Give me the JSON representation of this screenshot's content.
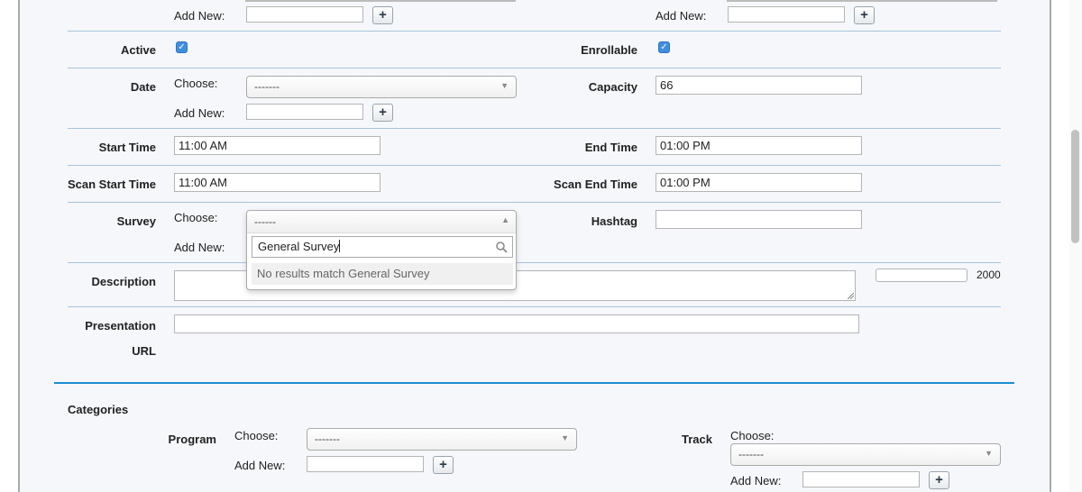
{
  "top_row": {
    "add_new_left": "Add New:",
    "add_new_right": "Add New:"
  },
  "active": {
    "label": "Active",
    "checked": true
  },
  "enrollable": {
    "label": "Enrollable",
    "checked": true
  },
  "date": {
    "label": "Date",
    "choose_label": "Choose:",
    "selected": "-------",
    "add_new_label": "Add New:"
  },
  "capacity": {
    "label": "Capacity",
    "value": "66"
  },
  "start_time": {
    "label": "Start Time",
    "value": "11:00 AM"
  },
  "end_time": {
    "label": "End Time",
    "value": "01:00 PM"
  },
  "scan_start_time": {
    "label": "Scan Start Time",
    "value": "11:00 AM"
  },
  "scan_end_time": {
    "label": "Scan End Time",
    "value": "01:00 PM"
  },
  "survey": {
    "label": "Survey",
    "choose_label": "Choose:",
    "selected": "------",
    "add_new_label": "Add New:",
    "search_value": "General Survey",
    "no_results": "No results match General Survey"
  },
  "hashtag": {
    "label": "Hashtag",
    "value": ""
  },
  "description": {
    "label": "Description",
    "char_limit": "2000"
  },
  "presentation_url": {
    "label_line1": "Presentation",
    "label_line2": "URL",
    "value": ""
  },
  "categories": {
    "title": "Categories",
    "program": {
      "label": "Program",
      "choose_label": "Choose:",
      "selected": "-------",
      "add_new_label": "Add New:"
    },
    "track": {
      "label": "Track",
      "choose_label": "Choose:",
      "selected": "-------",
      "add_new_label": "Add New:"
    }
  },
  "plus_symbol": "+",
  "check_symbol": "✓",
  "arrow_down": "▼",
  "arrow_up": "▲",
  "icons": [
    "checkbox-checked-icon",
    "search-icon",
    "chevron-down-icon",
    "chevron-up-icon",
    "plus-icon"
  ],
  "colors": {
    "accent_line": "#1b8fcf",
    "row_divider": "#a8c4dc",
    "checkbox": "#3f8ee0",
    "panel_bg": "#f5f7fa"
  }
}
